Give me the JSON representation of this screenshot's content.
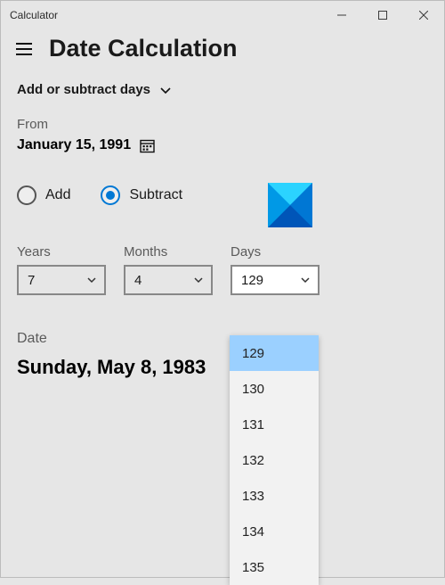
{
  "window": {
    "title": "Calculator"
  },
  "header": {
    "title": "Date Calculation"
  },
  "mode": {
    "label": "Add or subtract days"
  },
  "from": {
    "label": "From",
    "date": "January 15, 1991"
  },
  "operation": {
    "add_label": "Add",
    "subtract_label": "Subtract",
    "selected": "subtract"
  },
  "fields": {
    "years": {
      "label": "Years",
      "value": "7"
    },
    "months": {
      "label": "Months",
      "value": "4"
    },
    "days": {
      "label": "Days",
      "value": "129"
    }
  },
  "days_dropdown": {
    "options": [
      "129",
      "130",
      "131",
      "132",
      "133",
      "134",
      "135"
    ],
    "selected": "129"
  },
  "result": {
    "label": "Date",
    "value": "Sunday, May 8, 1983"
  },
  "colors": {
    "accent": "#0078d4"
  }
}
